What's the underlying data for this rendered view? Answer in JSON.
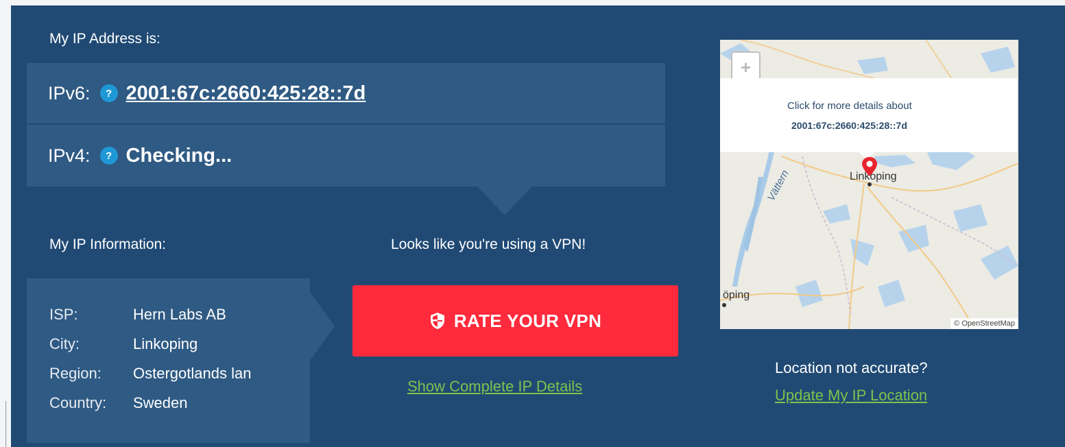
{
  "ip_section": {
    "heading": "My IP Address is:",
    "ipv6_label": "IPv6:",
    "ipv6_value": "2001:67c:2660:425:28::7d",
    "ipv4_label": "IPv4:",
    "ipv4_value": "Checking...",
    "help_glyph": "?"
  },
  "info_section": {
    "heading": "My IP Information:",
    "rows": [
      {
        "key": "ISP:",
        "value": "Hern Labs AB"
      },
      {
        "key": "City:",
        "value": "Linkoping"
      },
      {
        "key": "Region:",
        "value": "Ostergotlands lan"
      },
      {
        "key": "Country:",
        "value": "Sweden"
      }
    ]
  },
  "vpn": {
    "message": "Looks like you're using a VPN!",
    "rate_button": "RATE YOUR VPN",
    "details_link": "Show Complete IP Details"
  },
  "map": {
    "zoom_in": "+",
    "zoom_out": "−",
    "popup_line1": "Click for more details about",
    "popup_line2": "2001:67c:2660:425:28::7d",
    "city": "Linkoping",
    "city2": "öping",
    "lake": "Vättern",
    "attribution": "© OpenStreetMap"
  },
  "location": {
    "question": "Location not accurate?",
    "update_link": "Update My IP Location"
  },
  "colors": {
    "panel": "#204a74",
    "box": "#2f5a83",
    "button": "#ff2a3b",
    "link": "#7cc44e",
    "help": "#1f98d6"
  },
  "icons": [
    "help-icon",
    "shield-icon",
    "map-marker-icon"
  ]
}
